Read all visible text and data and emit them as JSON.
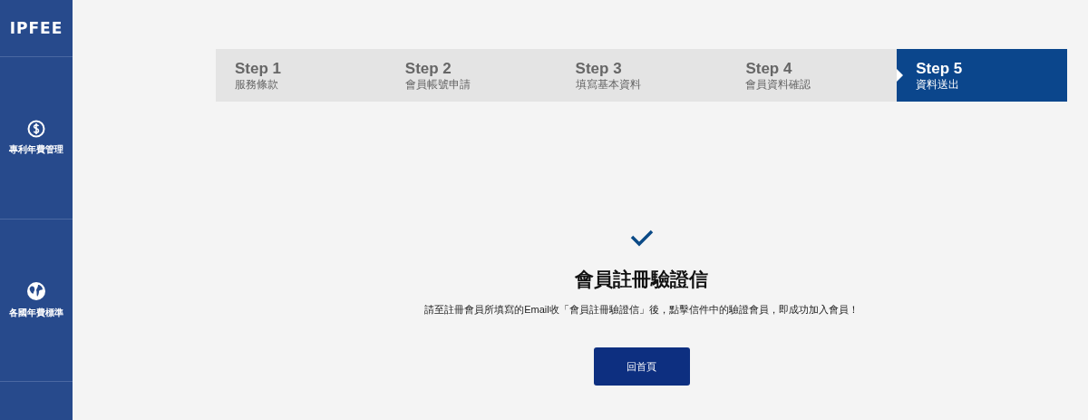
{
  "sidebar": {
    "logo": "IPFEE",
    "items": [
      {
        "kind": "dollar",
        "label": "專利年費管理"
      },
      {
        "kind": "globe",
        "label": "各國年費標準"
      }
    ]
  },
  "steps": [
    {
      "title": "Step 1",
      "subtitle": "服務條款",
      "selected": false
    },
    {
      "title": "Step 2",
      "subtitle": "會員帳號申請",
      "selected": false
    },
    {
      "title": "Step 3",
      "subtitle": "填寫基本資料",
      "selected": false
    },
    {
      "title": "Step 4",
      "subtitle": "會員資料確認",
      "selected": false
    },
    {
      "title": "Step 5",
      "subtitle": "資料送出",
      "selected": true
    }
  ],
  "result": {
    "title": "會員註冊驗證信",
    "message": "請至註冊會員所填寫的Email收「會員註冊驗證信」後，點擊信件中的驗證會員，即成功加入會員！",
    "button": "回首頁"
  }
}
